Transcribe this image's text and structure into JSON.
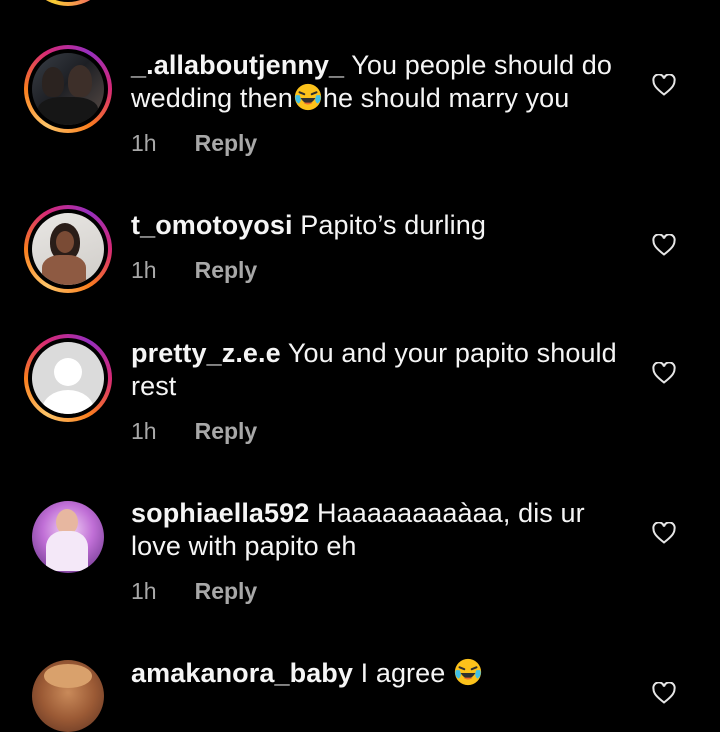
{
  "comments": [
    {
      "username": "_.allaboutjenny_",
      "text_before_emoji": "You people should do wedding then",
      "emoji": "face-with-tears-of-joy",
      "text_after_emoji": "he should marry you",
      "time": "1h",
      "reply_label": "Reply",
      "avatar_style": "story-ring"
    },
    {
      "username": "t_omotoyosi",
      "text": "Papito’s durling",
      "time": "1h",
      "reply_label": "Reply",
      "avatar_style": "story-ring"
    },
    {
      "username": "pretty_z.e.e",
      "text": "You and your papito should rest",
      "time": "1h",
      "reply_label": "Reply",
      "avatar_style": "story-ring-default-avatar"
    },
    {
      "username": "sophiaella592",
      "text": "Haaaaaaaaàaa, dis ur love with papito eh",
      "time": "1h",
      "reply_label": "Reply",
      "avatar_style": "plain"
    },
    {
      "username": "amakanora_baby",
      "text": "I agree",
      "emoji": "face-with-tears-of-joy",
      "avatar_style": "plain"
    }
  ],
  "icons": {
    "like": "heart-outline-icon"
  },
  "colors": {
    "background": "#000000",
    "text": "#f5f5f5",
    "meta": "#a8a8a8",
    "ring_start": "#fdc468",
    "ring_mid": "#d62976",
    "ring_end": "#962fbf"
  }
}
